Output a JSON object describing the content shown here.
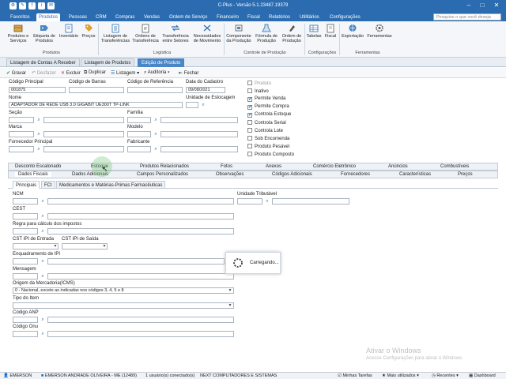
{
  "window": {
    "title": "C-Plus - Versão 5.1.23487.19379",
    "quick_icons": [
      "gear-icon",
      "edit-icon",
      "facebook-icon",
      "info-icon",
      "chat-icon"
    ],
    "controls": [
      "minimize-icon",
      "maximize-icon",
      "close-icon"
    ]
  },
  "ribbon_tabs": [
    "Favoritos",
    "Produtos",
    "Pessoas",
    "CRM",
    "Compras",
    "Vendas",
    "Ordem de Serviço",
    "Financeiro",
    "Fiscal",
    "Relatórios",
    "Utilitários",
    "Configurações"
  ],
  "search": {
    "placeholder": "Pesquise o que você deseja"
  },
  "ribbon": {
    "buttons": [
      {
        "label": "Produtos e\nServiços",
        "icon": "box-icon"
      },
      {
        "label": "Etiqueta de\nProdutos",
        "icon": "label-icon"
      },
      {
        "label": "Inventário",
        "icon": "inventory-icon"
      },
      {
        "label": "Preços",
        "icon": "price-icon"
      },
      {
        "label": "Listagem de\nTransferências",
        "icon": "list-icon"
      },
      {
        "label": "Ordens de\nTransferência",
        "icon": "order-icon"
      },
      {
        "label": "Transferência\nentre Setores",
        "icon": "transfer-icon"
      },
      {
        "label": "Necessidades\nde Movimento",
        "icon": "needs-icon"
      },
      {
        "label": "Componente\nda Produção",
        "icon": "component-icon"
      },
      {
        "label": "Fórmula de\nProdução",
        "icon": "formula-icon"
      },
      {
        "label": "Ordem de\nProdução",
        "icon": "production-icon"
      },
      {
        "label": "Tabelas",
        "icon": "table-icon"
      },
      {
        "label": "Fiscal",
        "icon": "fiscal-icon"
      },
      {
        "label": "Exportação",
        "icon": "export-icon"
      },
      {
        "label": "Ferramentas",
        "icon": "tools-icon"
      }
    ],
    "groups": [
      "Produtos",
      "Logística",
      "Controle de Produção",
      "Configurações",
      "Ferramentas"
    ]
  },
  "doc_tabs": [
    "Listagem de Contas A Receber",
    "Listagem de Produtos",
    "Edição de Produto"
  ],
  "toolbar": {
    "gravar": "Gravar",
    "desfazer": "Desfazer",
    "excluir": "Excluir",
    "duplicar": "Duplicar",
    "listagem": "Listagem",
    "auditoria": "Auditoria",
    "fechar": "Fechar"
  },
  "form": {
    "codigo_principal_label": "Código Principal",
    "codigo_principal": "001875",
    "codigo_barras_label": "Código de Barras",
    "codigo_referencia_label": "Código de Referência",
    "data_cadastro_label": "Data do Cadastro",
    "data_cadastro": "09/08/2021",
    "nome_label": "Nome",
    "nome": "ADAPTADOR DE REDE USB 3.0 GIGABIT UE300T TP-LINK",
    "unidade_label": "Unidade de Estocagem",
    "secao_label": "Seção",
    "familia_label": "Família",
    "marca_label": "Marca",
    "modelo_label": "Modelo",
    "fornecedor_label": "Fornecedor Principal",
    "fabricante_label": "Fabricante"
  },
  "produto_flags": {
    "title": "Produto",
    "items": [
      {
        "label": "Inativo",
        "checked": false
      },
      {
        "label": "Permite Venda",
        "checked": true
      },
      {
        "label": "Permite Compra",
        "checked": true
      },
      {
        "label": "Controla Estoque",
        "checked": true
      },
      {
        "label": "Controla Serial",
        "checked": false
      },
      {
        "label": "Controla Lote",
        "checked": false
      },
      {
        "label": "Sob Encomenda",
        "checked": false
      },
      {
        "label": "Produto Pesável",
        "checked": false
      },
      {
        "label": "Produto Composto",
        "checked": false
      }
    ]
  },
  "tabs_row1": [
    "Desconto Escalonado",
    "Estoque",
    "Produtos Relacionados",
    "Fotos",
    "Anexos",
    "Comércio Eletrônico",
    "Anúncios",
    "Combustíveis"
  ],
  "tabs_row2": [
    "Dados Fiscais",
    "Dados Adicionais",
    "Campos Personalizados",
    "Observações",
    "Códigos Adicionais",
    "Fornecedores",
    "Características",
    "Preços"
  ],
  "sub_tabs": [
    "Principais",
    "FCI",
    "Medicamentos e Matérias-Primas Farmacêuticas"
  ],
  "fiscal": {
    "ncm": "NCM",
    "unidade_tributavel": "Unidade Tributável",
    "cest": "CEST",
    "regra": "Regra para cálculo dos impostos",
    "cst_ipi_entrada": "CST IPI de Entrada",
    "cst_ipi_saida": "CST IPI de Saída",
    "enquadramento": "Enquadramento de IPI",
    "mensagem": "Mensagem",
    "origem": "Origem da Mercadoria(ICMS)",
    "origem_valor": "0 - Nacional, exceto as indicadas nos códigos 3, 4, 5 e 8",
    "tipo_item": "Tipo do Item",
    "codigo_anp": "Código ANP",
    "codigo_onu": "Código Onu"
  },
  "loading": "Carregando...",
  "watermark": {
    "line1": "Ativar o Windows",
    "line2": "Acesse Configurações para ativar o Windows."
  },
  "status": {
    "user": "EMERSON",
    "company": "EMERSON ANDRADE OLIVEIRA - ME (12489)",
    "connected": "1 usuário(s) conectado(s)",
    "network": "NEXT COMPUTADORES E SISTEMAS",
    "minhas_tarefas": "Minhas Tarefas",
    "mais_utilizados": "Mais utilizados",
    "recentes": "Recentes",
    "dashboard": "Dashboard"
  }
}
